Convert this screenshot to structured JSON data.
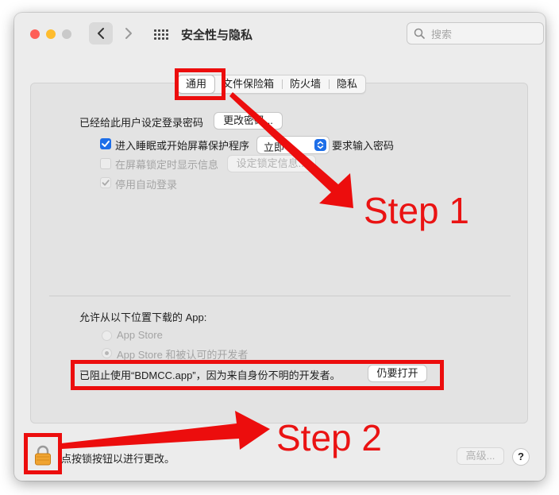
{
  "window": {
    "title": "安全性与隐私",
    "search_placeholder": "搜索"
  },
  "tabs": [
    {
      "label": "通用",
      "active": true
    },
    {
      "label": "文件保险箱",
      "active": false
    },
    {
      "label": "防火墙",
      "active": false
    },
    {
      "label": "隐私",
      "active": false
    }
  ],
  "general": {
    "password_label": "已经给此用户设定登录密码",
    "change_password_button": "更改密码...",
    "require_password": {
      "label": "进入睡眠或开始屏幕保护程序",
      "checked": true,
      "select_value": "立即",
      "suffix": "要求输入密码"
    },
    "show_message": {
      "label": "在屏幕锁定时显示信息",
      "checked": false,
      "button": "设定锁定信息..."
    },
    "disable_autologin": {
      "label": "停用自动登录",
      "checked": true
    }
  },
  "downloads": {
    "heading": "允许从以下位置下载的 App:",
    "options": [
      {
        "label": "App Store",
        "selected": false
      },
      {
        "label": "App Store 和被认可的开发者",
        "selected": true
      }
    ],
    "blocked_message": "已阻止使用“BDMCC.app”，因为来自身份不明的开发者。",
    "open_anyway_button": "仍要打开"
  },
  "footer": {
    "lock_text": "点按锁按钮以进行更改。",
    "advanced_button": "高级...",
    "help_button": "?"
  },
  "annotations": {
    "step1": "Step 1",
    "step2": "Step 2",
    "color": "#ec0d0d"
  },
  "colors": {
    "accent": "#1d6ee8",
    "close": "#fe5f57",
    "minimize": "#febc2e",
    "zoom_disabled": "#c9c9c9"
  }
}
